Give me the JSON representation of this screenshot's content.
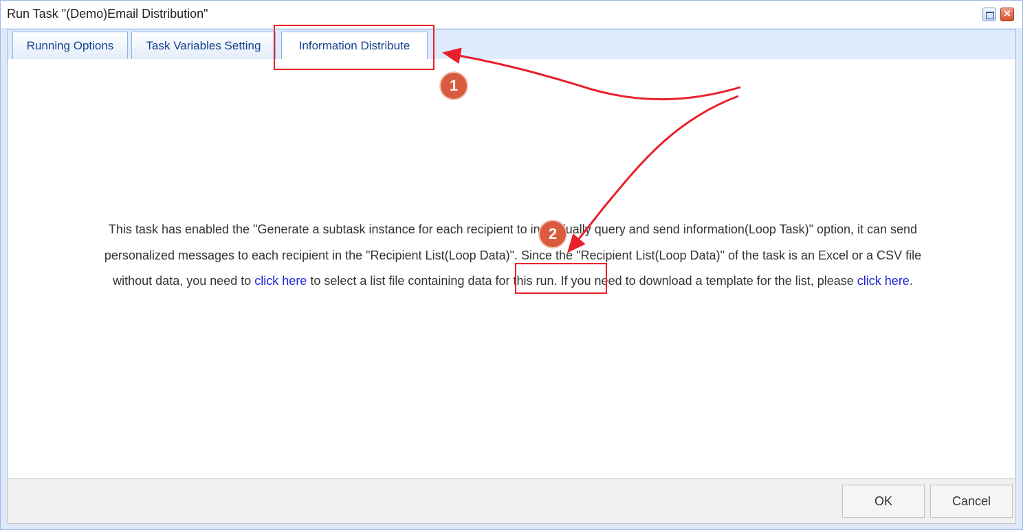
{
  "window": {
    "title": "Run Task \"(Demo)Email Distribution\"",
    "close_glyph": "×"
  },
  "tabs": [
    {
      "label": "Running Options"
    },
    {
      "label": "Task Variables Setting"
    },
    {
      "label": "Information Distribute",
      "active": true
    }
  ],
  "message": {
    "part1": "This task has enabled the \"Generate a subtask instance for each recipient to individually query and send information(Loop Task)\" option, it can send personalized messages to each recipient in the \"Recipient List(Loop Data)\". Since the \"Recipient List(Loop Data)\" of the task is an Excel or a CSV file without data, you need to ",
    "link1": "click here",
    "part2": " to select a list file containing data for this run. If you need to download a template for the list, please ",
    "link2": "click here",
    "part3": "."
  },
  "footer": {
    "ok_label": "OK",
    "cancel_label": "Cancel"
  },
  "annotations": {
    "badge1": "1",
    "badge2": "2",
    "color": "#e8202a"
  },
  "colors": {
    "accent_blue": "#99bbe8",
    "link": "#1a22d6",
    "badge": "#d95c3f"
  }
}
